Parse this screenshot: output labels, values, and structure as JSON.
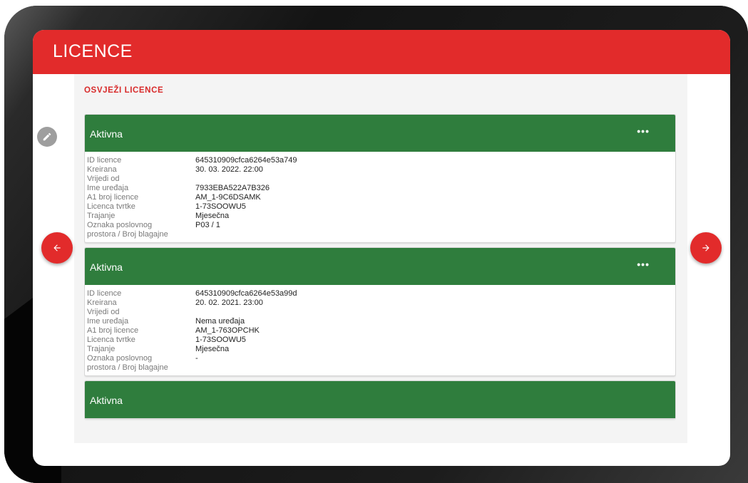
{
  "app": {
    "title": "LICENCE"
  },
  "actions": {
    "refresh_label": "OSVJEŽI LICENCE"
  },
  "icons": {
    "menu": "more-horizontal-icon",
    "prev": "arrow-left-icon",
    "next": "arrow-right-icon",
    "edit": "pencil-icon"
  },
  "colors": {
    "brand": "#e22b2b",
    "active": "#2f7d3d",
    "edit_fab": "#9e9e9e"
  },
  "labels": {
    "id": "ID licence",
    "created": "Kreirana",
    "valid_from": "Vrijedi od",
    "device": "Ime uređaja",
    "a1_number": "A1 broj licence",
    "company_license": "Licenca tvrtke",
    "duration": "Trajanje",
    "location_1": "Oznaka poslovnog",
    "location_2": "prostora / Broj blagajne"
  },
  "licenses": [
    {
      "status": "Aktivna",
      "menu": "•••",
      "id": "645310909cfca6264e53a749",
      "created": "30. 03. 2022. 22:00",
      "valid_from": "",
      "device": "7933EBA522A7B326",
      "a1_number": "AM_1-9C6DSAMK",
      "company_license": "1-73SOOWU5",
      "duration": "Mjesečna",
      "location": "P03 / 1"
    },
    {
      "status": "Aktivna",
      "menu": "•••",
      "id": "645310909cfca6264e53a99d",
      "created": "20. 02. 2021. 23:00",
      "valid_from": "",
      "device": "Nema uređaja",
      "a1_number": "AM_1-763OPCHK",
      "company_license": "1-73SOOWU5",
      "duration": "Mjesečna",
      "location": "-"
    },
    {
      "status": "Aktivna"
    }
  ]
}
